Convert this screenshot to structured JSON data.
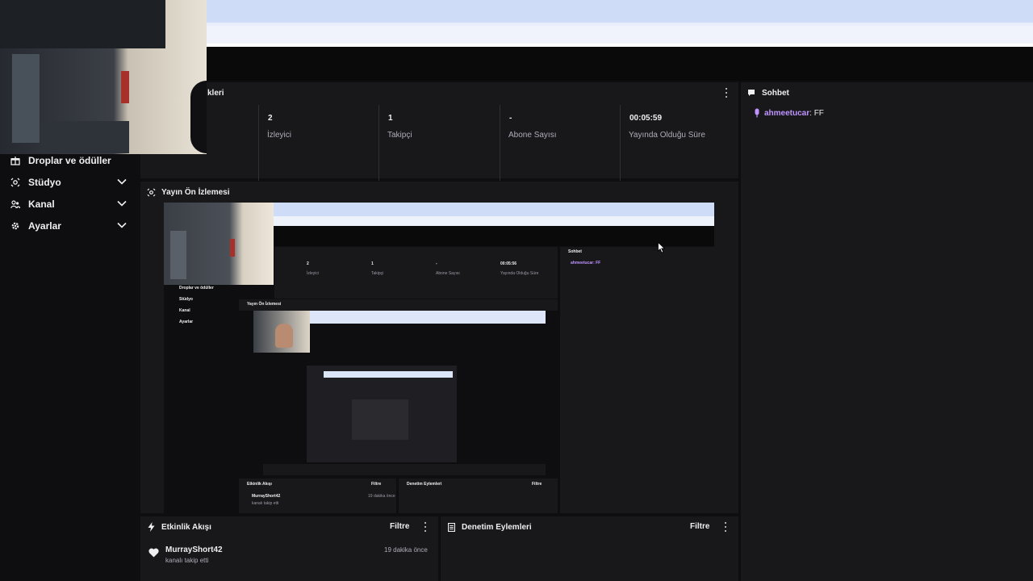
{
  "sidebar": {
    "items": [
      {
        "label": "Droplar ve ödüller",
        "icon": "gift-icon",
        "expandable": false
      },
      {
        "label": "Stüdyo",
        "icon": "studio-icon",
        "expandable": true
      },
      {
        "label": "Kanal",
        "icon": "users-icon",
        "expandable": true
      },
      {
        "label": "Ayarlar",
        "icon": "gear-icon",
        "expandable": true
      }
    ]
  },
  "stats_panel": {
    "title_partial": "kleri",
    "stats": [
      {
        "value": "2",
        "label": "İzleyici"
      },
      {
        "value": "1",
        "label": "Takipçi"
      },
      {
        "value": "-",
        "label": "Abone Sayısı"
      },
      {
        "value": "00:05:59",
        "label": "Yayında Olduğu Süre"
      }
    ]
  },
  "preview_panel": {
    "title": "Yayın Ön İzlemesi",
    "icon": "broadcast-icon",
    "nested": {
      "sidebar": [
        "Droplar ve ödüller",
        "Stüdyo",
        "Kanal",
        "Ayarlar"
      ],
      "stats": [
        {
          "value": "2",
          "label": "İzleyici"
        },
        {
          "value": "1",
          "label": "Takipçi"
        },
        {
          "value": "-",
          "label": "Abone Sayısı"
        },
        {
          "value": "00:05:56",
          "label": "Yayında Olduğu Süre"
        }
      ],
      "preview_title": "Yayın Ön İzlemesi",
      "chat_title": "Sohbet",
      "chat_line": "ahmeetucar: FF",
      "activity_title": "Etkinlik Akışı",
      "moderation_title": "Denetim Eylemleri",
      "filter_label": "Filtre",
      "event_user": "MurrayShort42",
      "event_action": "kanalı takip etti",
      "event_time": "19 dakika önce"
    }
  },
  "chat_panel": {
    "title": "Sohbet",
    "icon": "chat-icon",
    "messages": [
      {
        "user": "ahmeetucar",
        "text": ": FF",
        "user_color": "#bf94ff",
        "badge": "microphone-icon"
      }
    ]
  },
  "activity_panel": {
    "title": "Etkinlik Akışı",
    "icon": "lightning-icon",
    "filter_label": "Filtre",
    "events": [
      {
        "user": "MurrayShort42",
        "action": "kanalı takip etti",
        "time": "19 dakika önce",
        "icon": "heart-icon"
      }
    ]
  },
  "moderation_panel": {
    "title": "Denetim Eylemleri",
    "icon": "document-icon",
    "filter_label": "Filtre"
  },
  "colors": {
    "background": "#0e0e10",
    "panel": "#18181b",
    "accent_purple": "#bf94ff",
    "muted_text": "#adadb8"
  }
}
